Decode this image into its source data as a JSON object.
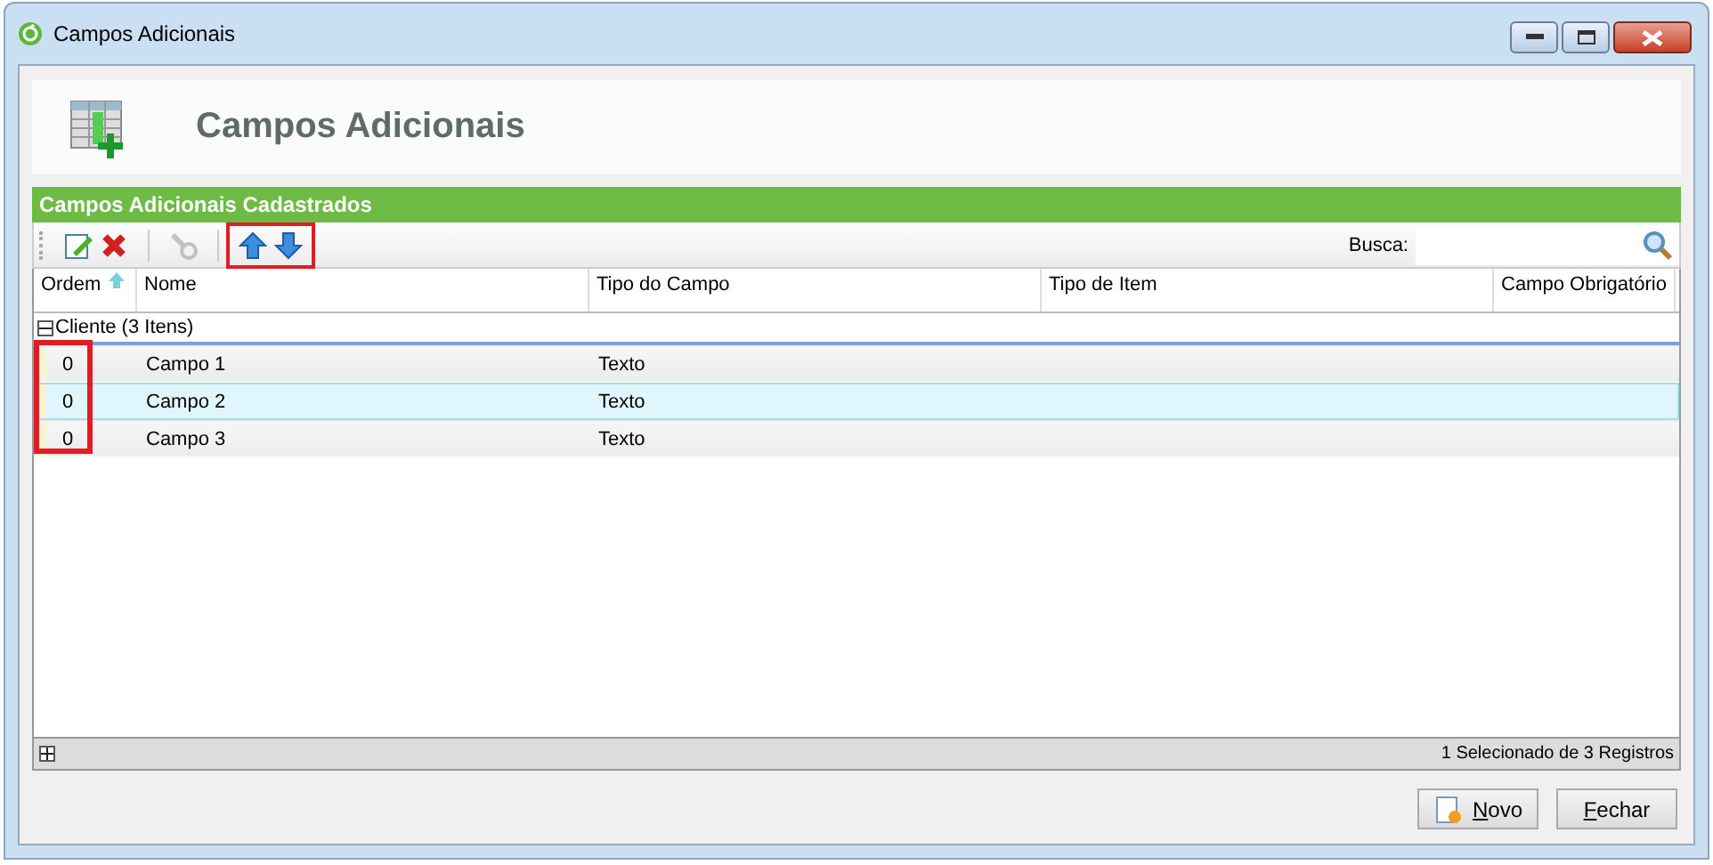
{
  "window": {
    "title": "Campos Adicionais"
  },
  "header": {
    "title": "Campos Adicionais"
  },
  "panel": {
    "title": "Campos Adicionais Cadastrados"
  },
  "toolbar": {
    "groups": [
      {
        "highlighted": false,
        "buttons": [
          {
            "kind": "edit",
            "disabled": false
          },
          {
            "kind": "delete",
            "disabled": false
          }
        ]
      },
      {
        "highlighted": false,
        "buttons": [
          {
            "kind": "tool",
            "disabled": true
          }
        ]
      },
      {
        "highlighted": true,
        "buttons": [
          {
            "kind": "up",
            "disabled": false
          },
          {
            "kind": "down",
            "disabled": false
          }
        ]
      }
    ],
    "search": {
      "label": "Busca:"
    }
  },
  "table": {
    "columns": [
      {
        "label": "Ordem",
        "sorted": true,
        "highlighted": true
      },
      {
        "label": "Nome",
        "sorted": false,
        "highlighted": false
      },
      {
        "label": "Tipo do Campo",
        "sorted": false,
        "highlighted": false
      },
      {
        "label": "Tipo de Item",
        "sorted": false,
        "highlighted": false
      },
      {
        "label": "Campo Obrigatório",
        "sorted": false,
        "highlighted": false
      }
    ],
    "group": {
      "label": "Cliente (3 Itens)",
      "expanded": true
    },
    "rows": [
      {
        "cells": [
          "0",
          "Campo 1",
          "Texto"
        ],
        "selected": false
      },
      {
        "cells": [
          "0",
          "Campo 2",
          "Texto"
        ],
        "selected": true
      },
      {
        "cells": [
          "0",
          "Campo 3",
          "Texto"
        ],
        "selected": false
      }
    ]
  },
  "status": "1 Selecionado de 3 Registros",
  "buttons": [
    {
      "label": "Novo",
      "kind": "new"
    },
    {
      "label": "Fechar",
      "kind": "close"
    }
  ]
}
